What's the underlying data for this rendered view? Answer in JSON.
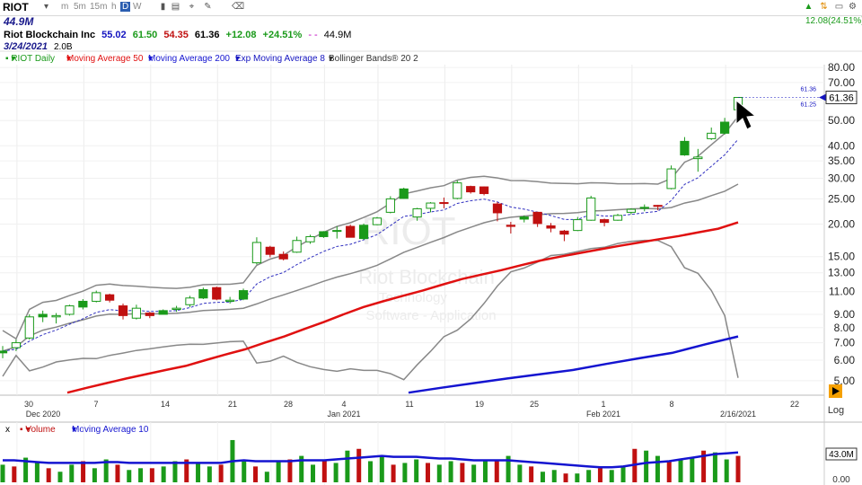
{
  "toolbar": {
    "symbol": "RIOT",
    "timeframes": [
      "m",
      "5m",
      "15m",
      "h",
      "D",
      "W"
    ],
    "selected_timeframe": "D",
    "icons": [
      "bar-style-icon",
      "chart-style-icon",
      "draw-icon",
      "pencil-icon",
      "erase-icon"
    ]
  },
  "header": {
    "volume_label": "44.9M",
    "name": "Riot Blockchain Inc",
    "date": "3/24/2021",
    "shares": "2.0B",
    "open": "55.02",
    "high": "61.50",
    "low": "54.35",
    "close": "61.36",
    "change": "+12.08",
    "change_pct": "+24.51%",
    "volume": "44.9M",
    "top_right_change": "12.08(24.51%)"
  },
  "studies": {
    "main": "RIOT Daily",
    "ma50": "Moving Average 50",
    "ma200": "Moving Average 200",
    "ema8": "Exp Moving Average 8",
    "bb": "Bollinger Bands® 20 2",
    "volume": "Volume",
    "vol_ma": "Moving Average 10",
    "x_label": "x"
  },
  "watermark": {
    "symbol": "RIOT",
    "name": "Riot Blockchain",
    "sector": "Technology",
    "industry": "Software - Application"
  },
  "price_axis": {
    "labels": [
      "80.00",
      "70.00",
      "60.00",
      "50.00",
      "40.00",
      "35.00",
      "30.00",
      "25.00",
      "20.00",
      "15.00",
      "13.00",
      "11.00",
      "9.00",
      "8.00",
      "7.00",
      "6.00",
      "5.00"
    ],
    "current": "61.36",
    "bid": "61.36",
    "ask": "61.25",
    "scale": "Log"
  },
  "volume_axis": {
    "current": "43.0M",
    "base": "0.00"
  },
  "time_axis": {
    "ticks": [
      "30",
      "Dec 2020",
      "7",
      "14",
      "21",
      "28",
      "4",
      "Jan 2021",
      "11",
      "19",
      "25",
      "1",
      "Feb 2021",
      "8",
      "2/16/2021",
      "22"
    ]
  },
  "colors": {
    "up": "#1a9a1a",
    "down": "#c01010",
    "ma50": "#e01010",
    "ma200": "#1414d0",
    "ema8": "#3030c0",
    "bb": "#888888",
    "accent": "#f5a000"
  },
  "chart_data": {
    "type": "candlestick",
    "y_scale": "log",
    "ylim": [
      4.4,
      82
    ],
    "dates": [
      "11/27",
      "11/30",
      "12/1",
      "12/2",
      "12/3",
      "12/4",
      "12/7",
      "12/8",
      "12/9",
      "12/10",
      "12/11",
      "12/14",
      "12/15",
      "12/16",
      "12/17",
      "12/18",
      "12/21",
      "12/22",
      "12/23",
      "12/24",
      "12/28",
      "12/29",
      "12/30",
      "12/31",
      "1/4",
      "1/5",
      "1/6",
      "1/7",
      "1/8",
      "1/11",
      "1/12",
      "1/13",
      "1/14",
      "1/15",
      "1/19",
      "1/20",
      "1/21",
      "1/22",
      "1/25",
      "1/26",
      "1/27",
      "1/28",
      "1/29",
      "2/1",
      "2/2",
      "2/3",
      "2/4",
      "2/5",
      "2/8",
      "2/9",
      "2/10",
      "2/11",
      "2/12",
      "2/16"
    ],
    "candles": [
      {
        "o": 6.4,
        "h": 6.8,
        "l": 6.1,
        "c": 6.5
      },
      {
        "o": 6.7,
        "h": 7.2,
        "l": 6.5,
        "c": 7.0
      },
      {
        "o": 7.3,
        "h": 9.0,
        "l": 7.2,
        "c": 8.8
      },
      {
        "o": 8.8,
        "h": 9.3,
        "l": 8.4,
        "c": 9.0
      },
      {
        "o": 8.8,
        "h": 9.1,
        "l": 8.3,
        "c": 8.9
      },
      {
        "o": 9.0,
        "h": 9.8,
        "l": 8.9,
        "c": 9.7
      },
      {
        "o": 9.6,
        "h": 10.3,
        "l": 9.4,
        "c": 10.1
      },
      {
        "o": 10.1,
        "h": 11.1,
        "l": 10.0,
        "c": 10.9
      },
      {
        "o": 10.7,
        "h": 10.8,
        "l": 10.0,
        "c": 10.2
      },
      {
        "o": 9.7,
        "h": 9.9,
        "l": 8.6,
        "c": 8.9
      },
      {
        "o": 8.7,
        "h": 9.8,
        "l": 8.6,
        "c": 9.5
      },
      {
        "o": 9.1,
        "h": 9.2,
        "l": 8.7,
        "c": 8.9
      },
      {
        "o": 9.0,
        "h": 9.4,
        "l": 9.0,
        "c": 9.3
      },
      {
        "o": 9.4,
        "h": 9.7,
        "l": 9.2,
        "c": 9.5
      },
      {
        "o": 9.8,
        "h": 10.6,
        "l": 9.6,
        "c": 10.4
      },
      {
        "o": 10.4,
        "h": 11.4,
        "l": 10.3,
        "c": 11.2
      },
      {
        "o": 11.4,
        "h": 11.5,
        "l": 10.2,
        "c": 10.3
      },
      {
        "o": 10.1,
        "h": 10.5,
        "l": 9.9,
        "c": 10.2
      },
      {
        "o": 10.3,
        "h": 11.3,
        "l": 10.2,
        "c": 11.1
      },
      {
        "o": 14.2,
        "h": 17.8,
        "l": 14.0,
        "c": 17.0
      },
      {
        "o": 16.3,
        "h": 16.5,
        "l": 14.9,
        "c": 15.3
      },
      {
        "o": 15.3,
        "h": 15.7,
        "l": 14.5,
        "c": 14.7
      },
      {
        "o": 15.6,
        "h": 17.9,
        "l": 15.5,
        "c": 17.3
      },
      {
        "o": 17.1,
        "h": 18.2,
        "l": 16.8,
        "c": 17.9
      },
      {
        "o": 17.9,
        "h": 18.8,
        "l": 17.7,
        "c": 18.7
      },
      {
        "o": 18.9,
        "h": 19.6,
        "l": 17.6,
        "c": 18.9
      },
      {
        "o": 19.6,
        "h": 19.9,
        "l": 17.8,
        "c": 17.8
      },
      {
        "o": 17.6,
        "h": 20.1,
        "l": 17.4,
        "c": 19.8
      },
      {
        "o": 19.9,
        "h": 21.3,
        "l": 19.8,
        "c": 21.1
      },
      {
        "o": 22.2,
        "h": 25.6,
        "l": 22.0,
        "c": 25.0
      },
      {
        "o": 25.1,
        "h": 27.6,
        "l": 25.0,
        "c": 27.3
      },
      {
        "o": 21.3,
        "h": 23.1,
        "l": 20.6,
        "c": 22.9
      },
      {
        "o": 23.0,
        "h": 24.3,
        "l": 22.2,
        "c": 24.1
      },
      {
        "o": 24.2,
        "h": 25.3,
        "l": 23.0,
        "c": 24.0
      },
      {
        "o": 25.1,
        "h": 29.4,
        "l": 24.9,
        "c": 28.8
      },
      {
        "o": 27.9,
        "h": 28.1,
        "l": 26.2,
        "c": 26.6
      },
      {
        "o": 27.8,
        "h": 27.9,
        "l": 25.8,
        "c": 26.2
      },
      {
        "o": 23.9,
        "h": 24.3,
        "l": 20.5,
        "c": 22.1
      },
      {
        "o": 19.8,
        "h": 20.4,
        "l": 18.4,
        "c": 19.6
      },
      {
        "o": 20.9,
        "h": 21.6,
        "l": 20.3,
        "c": 21.3
      },
      {
        "o": 22.2,
        "h": 22.3,
        "l": 19.5,
        "c": 20.1
      },
      {
        "o": 19.7,
        "h": 20.2,
        "l": 18.6,
        "c": 19.3
      },
      {
        "o": 18.8,
        "h": 19.0,
        "l": 17.2,
        "c": 18.3
      },
      {
        "o": 18.9,
        "h": 21.3,
        "l": 18.8,
        "c": 20.8
      },
      {
        "o": 20.7,
        "h": 25.7,
        "l": 20.6,
        "c": 25.2
      },
      {
        "o": 20.8,
        "h": 21.0,
        "l": 19.6,
        "c": 20.3
      },
      {
        "o": 20.7,
        "h": 21.9,
        "l": 20.6,
        "c": 21.6
      },
      {
        "o": 22.2,
        "h": 23.0,
        "l": 21.8,
        "c": 22.8
      },
      {
        "o": 23.0,
        "h": 23.8,
        "l": 22.4,
        "c": 23.2
      },
      {
        "o": 23.6,
        "h": 23.7,
        "l": 22.6,
        "c": 23.4
      },
      {
        "o": 27.4,
        "h": 33.6,
        "l": 27.2,
        "c": 32.6
      },
      {
        "o": 36.9,
        "h": 43.2,
        "l": 36.6,
        "c": 41.6
      },
      {
        "o": 35.7,
        "h": 38.9,
        "l": 31.8,
        "c": 36.2
      },
      {
        "o": 42.6,
        "h": 47.0,
        "l": 42.1,
        "c": 44.7
      }
    ],
    "last_candle": {
      "o": 48.8,
      "h": 53.5,
      "l": 48.0,
      "c": 52.6
    },
    "extra_candles": [
      {
        "o": 44.7,
        "h": 51.2,
        "l": 44.2,
        "c": 49.3
      },
      {
        "o": 55.02,
        "h": 61.5,
        "l": 54.35,
        "c": 61.36
      }
    ],
    "ma50": [
      4.5,
      4.7,
      4.9,
      5.1,
      5.3,
      5.5,
      5.7,
      6.0,
      6.3,
      6.6,
      7.0,
      7.4,
      7.9,
      8.4,
      9.0,
      9.6,
      10.1,
      10.6,
      11.1,
      11.7,
      12.3,
      12.8,
      13.3,
      13.9,
      14.5,
      15.0,
      15.5,
      16.0,
      16.5,
      17.0,
      17.5,
      18.0,
      18.6,
      19.2,
      20.3
    ],
    "ma200": [
      4.5,
      4.7,
      4.9,
      5.1,
      5.3,
      5.5,
      5.8,
      6.1,
      6.4,
      6.9,
      7.4
    ],
    "volume_values": [
      20,
      18,
      28,
      22,
      16,
      12,
      20,
      24,
      16,
      26,
      20,
      14,
      16,
      16,
      18,
      24,
      26,
      22,
      18,
      20,
      48,
      26,
      18,
      12,
      24,
      26,
      30,
      20,
      24,
      22,
      36,
      38,
      24,
      30,
      20,
      22,
      26,
      22,
      20,
      24,
      22,
      20,
      24,
      26,
      30,
      20,
      18,
      12,
      14,
      10,
      10,
      14,
      16,
      14,
      18,
      38,
      36,
      30,
      24,
      26,
      28,
      36,
      34,
      26,
      30
    ],
    "volume_ma": [
      25,
      25,
      24,
      23,
      22,
      22,
      22,
      22,
      22,
      23,
      23,
      22,
      22,
      22,
      22,
      22,
      22,
      22,
      22,
      22,
      24,
      25,
      24,
      24,
      24,
      24,
      25,
      25,
      25,
      26,
      27,
      28,
      29,
      30,
      29,
      29,
      29,
      28,
      27,
      27,
      26,
      25,
      25,
      25,
      25,
      24,
      23,
      22,
      21,
      20,
      19,
      18,
      17,
      17,
      18,
      20,
      22,
      23,
      24,
      26,
      28,
      30,
      32,
      33,
      34
    ]
  }
}
